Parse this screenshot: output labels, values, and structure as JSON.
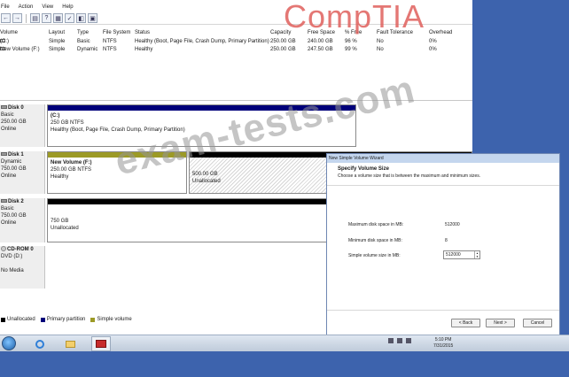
{
  "menu": [
    "File",
    "Action",
    "View",
    "Help"
  ],
  "toolbar_icons": [
    "back-icon",
    "forward-icon",
    "list-icon",
    "help-icon",
    "properties-icon",
    "refresh-icon",
    "settings-icon",
    "export-icon"
  ],
  "volumes": {
    "headers": [
      "Volume",
      "Layout",
      "Type",
      "File System",
      "Status",
      "Capacity",
      "Free Space",
      "% Free",
      "Fault Tolerance",
      "Overhead"
    ],
    "rows": [
      [
        "(C:)",
        "Simple",
        "Basic",
        "NTFS",
        "Healthy (Boot, Page File, Crash Dump, Primary Partition)",
        "250.00 GB",
        "240.00 GB",
        "96 %",
        "No",
        "0%"
      ],
      [
        "New Volume (F:)",
        "Simple",
        "Dynamic",
        "NTFS",
        "Healthy",
        "250.00 GB",
        "247.50 GB",
        "99 %",
        "No",
        "0%"
      ]
    ]
  },
  "disks": [
    {
      "name": "Disk 0",
      "type": "Basic",
      "size": "250.00 GB",
      "status": "Online",
      "partitions": [
        {
          "name": "(C:)",
          "size": "250 GB NTFS",
          "status": "Healthy (Boot, Page File, Crash Dump, Primary Partition)",
          "kind": "primary"
        }
      ]
    },
    {
      "name": "Disk 1",
      "type": "Dynamic",
      "size": "750.00 GB",
      "status": "Online",
      "partitions": [
        {
          "name": "New Volume (F:)",
          "size": "250.00 GB NTFS",
          "status": "Healthy",
          "kind": "simple"
        },
        {
          "name": "",
          "size": "500.00 GB",
          "status": "Unallocated",
          "kind": "unallocated"
        }
      ]
    },
    {
      "name": "Disk 2",
      "type": "Basic",
      "size": "750.00 GB",
      "status": "Online",
      "partitions": [
        {
          "name": "",
          "size": "750 GB",
          "status": "Unallocated",
          "kind": "unallocated"
        }
      ]
    },
    {
      "name": "CD-ROM 0",
      "type": "DVD (D:)",
      "size": "",
      "status": "No Media",
      "partitions": []
    }
  ],
  "legend": [
    {
      "label": "Unallocated",
      "color": "#000000"
    },
    {
      "label": "Primary partition",
      "color": "#00007a"
    },
    {
      "label": "Simple volume",
      "color": "#9c9a26"
    }
  ],
  "wizard": {
    "title": "New Simple Volume Wizard",
    "heading": "Specify Volume Size",
    "subheading": "Choose a volume size that is between the maximum and minimum sizes.",
    "fields": [
      {
        "label": "Maximum disk space in MB:",
        "value": "512000"
      },
      {
        "label": "Minimum disk space in MB:",
        "value": "8"
      },
      {
        "label": "Simple volume size in MB:",
        "value": "512000"
      }
    ],
    "buttons": {
      "back": "< Back",
      "next": "Next >",
      "cancel": "Cancel"
    }
  },
  "taskbar": {
    "time": "5:10 PM",
    "date": "7/31/2015"
  },
  "watermarks": {
    "comptia": "CompTIA",
    "exam": "exam-tests.com"
  },
  "colors": {
    "primary": "#00007a",
    "simple": "#9c9a26",
    "unallocated": "#000000",
    "desktop": "#3d63ad"
  }
}
